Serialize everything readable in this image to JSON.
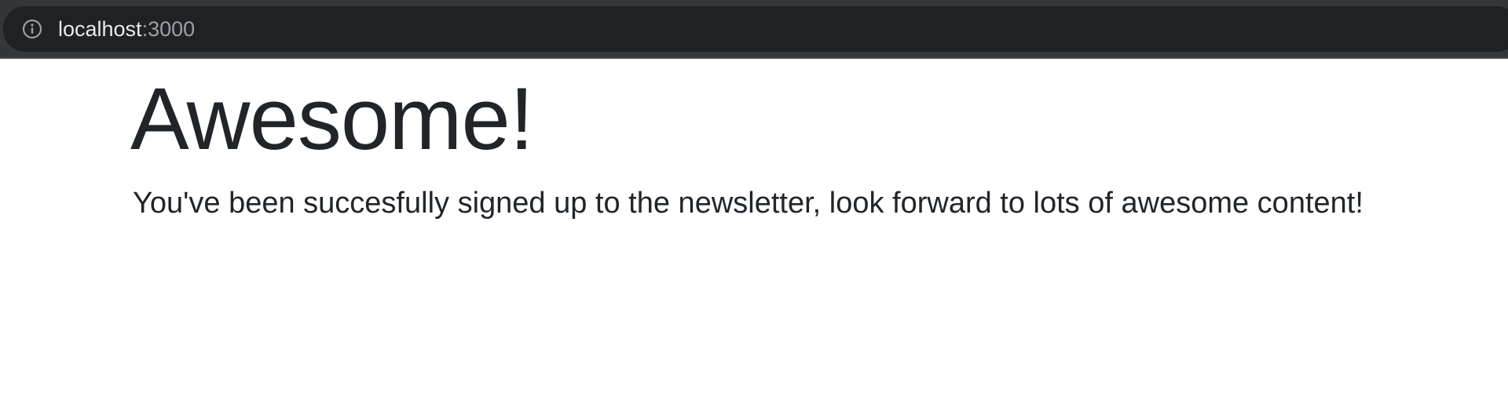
{
  "browser": {
    "url_host": "localhost",
    "url_port": ":3000",
    "info_icon": "info-icon"
  },
  "page": {
    "heading": "Awesome!",
    "message": "You've been succesfully signed up to the newsletter, look forward to lots of awesome content!"
  },
  "colors": {
    "chrome_bg": "#35363a",
    "address_bar_bg": "#202124",
    "text": "#212529"
  }
}
